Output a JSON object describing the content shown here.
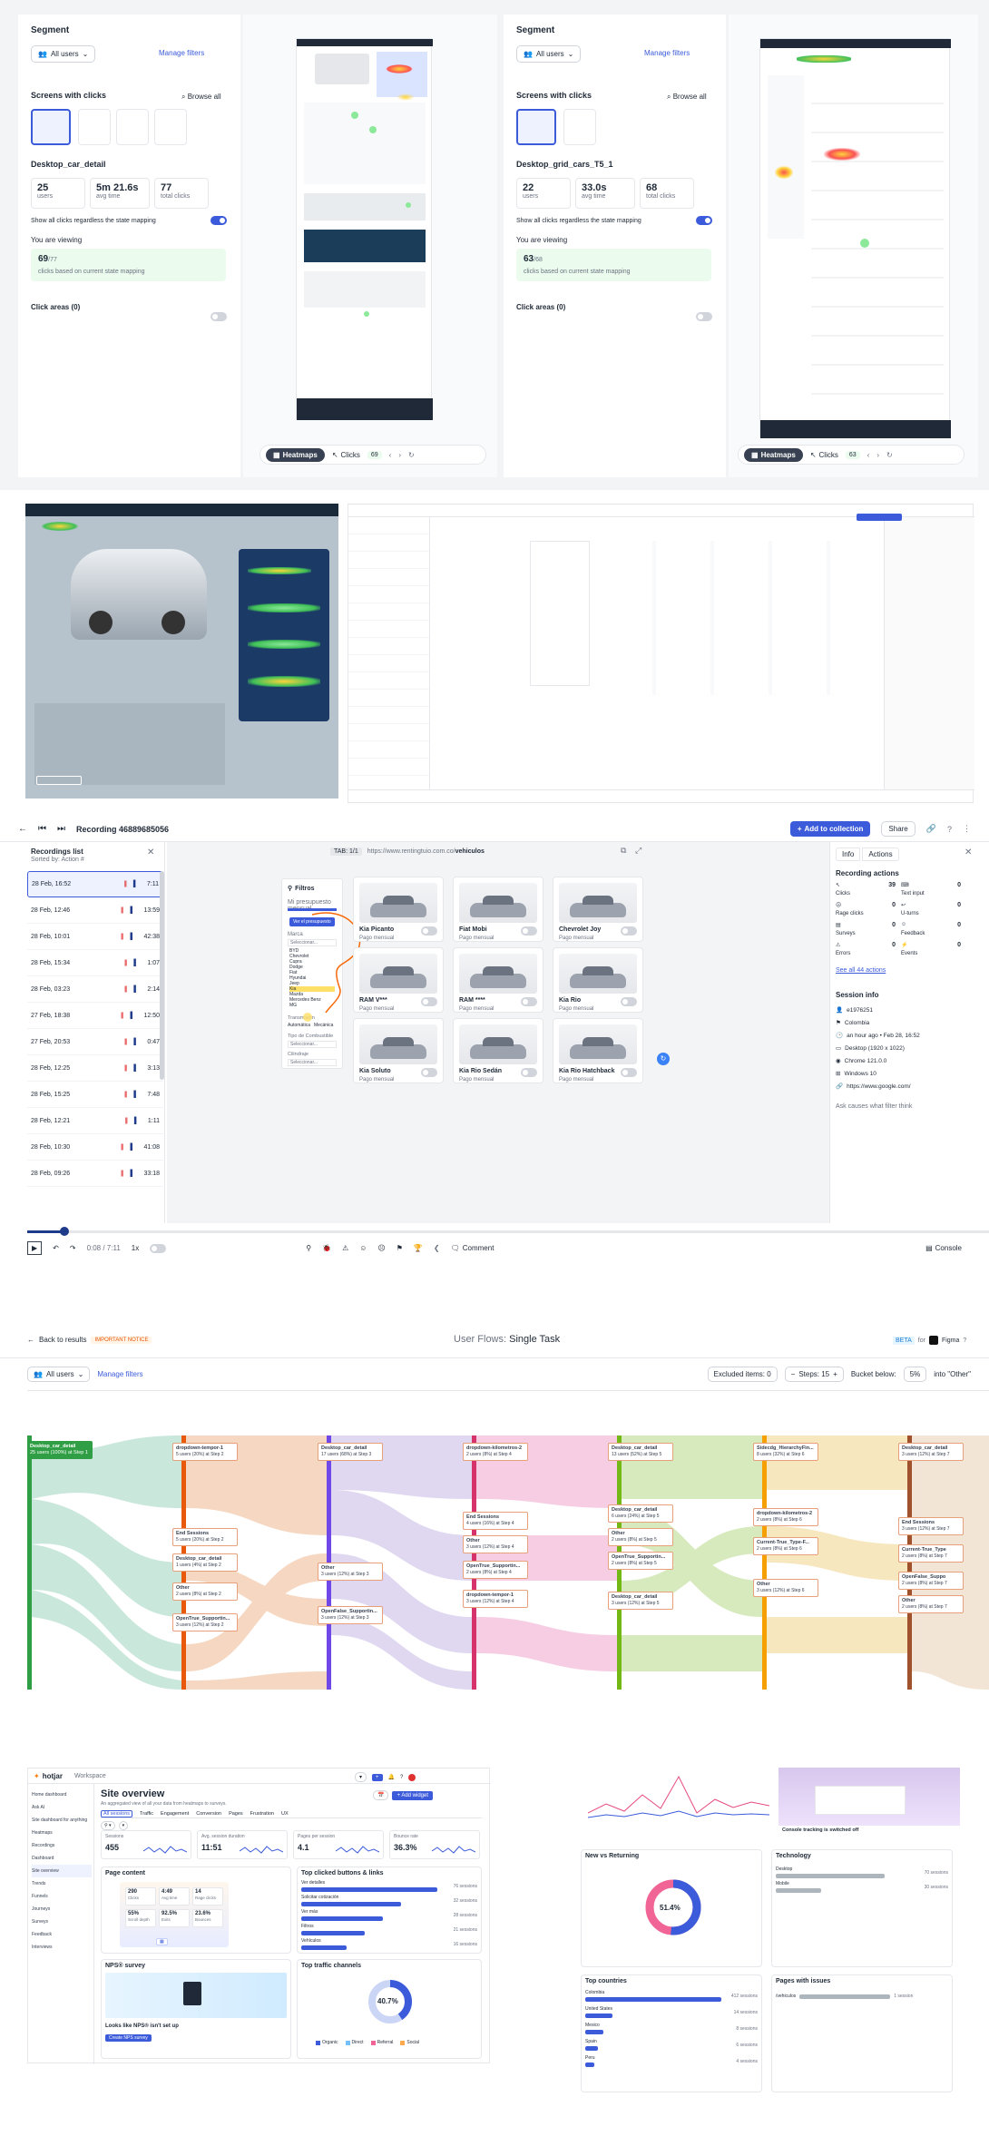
{
  "panel1": {
    "segment_label": "Segment",
    "segment_value": "All users",
    "manage_filters": "Manage filters",
    "screens_label": "Screens with clicks",
    "browse_all": "Browse all",
    "screen_name": "Desktop_car_detail",
    "stats": [
      {
        "value": "25",
        "label": "users"
      },
      {
        "value": "5m 21.6s",
        "label": "avg time"
      },
      {
        "value": "77",
        "label": "total clicks"
      }
    ],
    "show_all_clicks": "Show all clicks regardless the state mapping",
    "viewing_label": "You are viewing",
    "viewing_count": "69",
    "viewing_total": "/77",
    "viewing_sub": "clicks based on current state mapping",
    "click_areas": "Click areas (0)",
    "tab_heatmaps": "Heatmaps",
    "tab_clicks": "Clicks",
    "clicks_badge": "69"
  },
  "panel2": {
    "segment_label": "Segment",
    "segment_value": "All users",
    "manage_filters": "Manage filters",
    "screens_label": "Screens with clicks",
    "browse_all": "Browse all",
    "screen_name": "Desktop_grid_cars_T5_1",
    "stats": [
      {
        "value": "22",
        "label": "users"
      },
      {
        "value": "33.0s",
        "label": "avg time"
      },
      {
        "value": "68",
        "label": "total clicks"
      }
    ],
    "show_all_clicks": "Show all clicks regardless the state mapping",
    "viewing_label": "You are viewing",
    "viewing_count": "63",
    "viewing_total": "/68",
    "viewing_sub": "clicks based on current state mapping",
    "click_areas": "Click areas (0)",
    "tab_heatmaps": "Heatmaps",
    "tab_clicks": "Clicks",
    "clicks_badge": "63"
  },
  "recording": {
    "title": "Recording 46889685056",
    "add_collection": "Add to collection",
    "share": "Share",
    "list_title": "Recordings list",
    "list_sub": "Sorted by: Action #",
    "tab": "TAB: 1/1",
    "url_base": "https://www.rentingtuio.com.co/",
    "url_path": "vehiculos",
    "recordings": [
      {
        "date": "28 Feb, 16:52",
        "dur": "7:11"
      },
      {
        "date": "28 Feb, 12:46",
        "dur": "13:59"
      },
      {
        "date": "28 Feb, 10:01",
        "dur": "42:38"
      },
      {
        "date": "28 Feb, 15:34",
        "dur": "1:07"
      },
      {
        "date": "28 Feb, 03:23",
        "dur": "2:14"
      },
      {
        "date": "27 Feb, 18:38",
        "dur": "12:50"
      },
      {
        "date": "27 Feb, 20:53",
        "dur": "0:47"
      },
      {
        "date": "28 Feb, 12:25",
        "dur": "3:13"
      },
      {
        "date": "28 Feb, 15:25",
        "dur": "7:48"
      },
      {
        "date": "28 Feb, 12:21",
        "dur": "1:11"
      },
      {
        "date": "28 Feb, 10:30",
        "dur": "41:08"
      },
      {
        "date": "28 Feb, 09:26",
        "dur": "33:18"
      }
    ],
    "filters_title": "Filtros",
    "filter_budget": "Mi presupuesto mensual",
    "filter_button": "Ver el presupuesto",
    "filter_brand": "Marca",
    "filter_select": "Seleccionar...",
    "brands": [
      "BYD",
      "Chevrolet",
      "Cupra",
      "Dodge",
      "Fiat",
      "Hyundai",
      "Jeep",
      "Kia",
      "Mazda",
      "Mercedes Benz",
      "MG"
    ],
    "filter_trans": "Transmisión",
    "trans_opts": [
      "Automática",
      "Mecánica"
    ],
    "filter_fuel": "Tipo de Combustible",
    "filter_body": "Cilindraje",
    "cars": [
      {
        "name": "Kia Picanto",
        "price": "Pago mensual"
      },
      {
        "name": "Fiat Mobi",
        "price": "Pago mensual"
      },
      {
        "name": "Chevrolet Joy",
        "price": "Pago mensual"
      },
      {
        "name": "RAM V***",
        "price": "Pago mensual"
      },
      {
        "name": "RAM ****",
        "price": "Pago mensual"
      },
      {
        "name": "Kia Rio",
        "price": "Pago mensual"
      },
      {
        "name": "Kia Soluto",
        "price": "Pago mensual"
      },
      {
        "name": "Kia Rio Sedán",
        "price": "Pago mensual"
      },
      {
        "name": "Kia Rio Hatchback",
        "price": "Pago mensual"
      }
    ],
    "tab_info": "Info",
    "tab_actions": "Actions",
    "rec_actions_title": "Recording actions",
    "actions": [
      {
        "label": "Clicks",
        "value": "39"
      },
      {
        "label": "Text input",
        "value": "0"
      },
      {
        "label": "Rage clicks",
        "value": "0"
      },
      {
        "label": "U-turns",
        "value": "0"
      },
      {
        "label": "Surveys",
        "value": "0"
      },
      {
        "label": "Feedback",
        "value": "0"
      },
      {
        "label": "Errors",
        "value": "0"
      },
      {
        "label": "Events",
        "value": "0"
      }
    ],
    "see_all": "See all 44 actions",
    "session_title": "Session info",
    "session": [
      "e1976251",
      "Colombia",
      "an hour ago • Feb 28, 16:52",
      "Desktop (1920 x 1022)",
      "Chrome 121.0.0",
      "Windows 10",
      "https://www.google.com/"
    ],
    "ask": "Ask causes what filter think",
    "time": "0:08 / 7:11",
    "speed": "1x",
    "comment": "Comment",
    "console": "Console"
  },
  "flows": {
    "back": "Back to results",
    "notice": "IMPORTANT NOTICE",
    "title_prefix": "User Flows: ",
    "title": "Single Task",
    "beta": "BETA",
    "for": "for",
    "figma": "Figma",
    "segment": "All users",
    "manage": "Manage filters",
    "excluded": "Excluded items: 0",
    "steps": "Steps: 15",
    "bucket": "Bucket below:",
    "bucket_val": "5%",
    "into_other": "into \"Other\"",
    "start_node": {
      "title": "Desktop_car_detail",
      "sub": "25 users (100%) at Step 1"
    },
    "nodes": [
      {
        "title": "dropdown-tempor-1",
        "sub": "5 users (20%) at Step 2"
      },
      {
        "title": "End Sessions",
        "sub": "5 users (20%) at Step 2"
      },
      {
        "title": "Desktop_car_detail",
        "sub": "1 users (4%) at Step 2"
      },
      {
        "title": "Other",
        "sub": "2 users (8%) at Step 2"
      },
      {
        "title": "OpenTrue_Supportin...",
        "sub": "3 users (12%) at Step 2"
      },
      {
        "title": "Desktop_car_detail",
        "sub": "17 users (68%) at Step 3"
      },
      {
        "title": "Other",
        "sub": "3 users (12%) at Step 3"
      },
      {
        "title": "OpenFalse_Supportin...",
        "sub": "3 users (12%) at Step 3"
      },
      {
        "title": "dropdown-kilometros-2",
        "sub": "2 users (8%) at Step 4"
      },
      {
        "title": "End Sessions",
        "sub": "4 users (16%) at Step 4"
      },
      {
        "title": "Other",
        "sub": "3 users (12%) at Step 4"
      },
      {
        "title": "OpenTrue_Supportin...",
        "sub": "2 users (8%) at Step 4"
      },
      {
        "title": "dropdown-tempor-1",
        "sub": "3 users (12%) at Step 4"
      },
      {
        "title": "Desktop_car_detail",
        "sub": "13 users (52%) at Step 5"
      },
      {
        "title": "Desktop_car_detail",
        "sub": "6 users (24%) at Step 5"
      },
      {
        "title": "Other",
        "sub": "2 users (8%) at Step 5"
      },
      {
        "title": "OpenTrue_Supportin...",
        "sub": "2 users (8%) at Step 5"
      },
      {
        "title": "Desktop_car_detail",
        "sub": "3 users (12%) at Step 5"
      },
      {
        "title": "Sidecdg_HierarchyFin...",
        "sub": "8 users (32%) at Step 6"
      },
      {
        "title": "dropdown-kilometros-2",
        "sub": "2 users (8%) at Step 6"
      },
      {
        "title": "Current-True_Type-F...",
        "sub": "2 users (8%) at Step 6"
      },
      {
        "title": "Other",
        "sub": "3 users (12%) at Step 6"
      },
      {
        "title": "Desktop_car_detail",
        "sub": "3 users (12%) at Step 7"
      },
      {
        "title": "End Sessions",
        "sub": "3 users (12%) at Step 7"
      },
      {
        "title": "Current-True_Type",
        "sub": "2 users (8%) at Step 7"
      },
      {
        "title": "OpenFalse_Suppo",
        "sub": "2 users (8%) at Step 7"
      },
      {
        "title": "Other",
        "sub": "2 users (8%) at Step 7"
      }
    ]
  },
  "dashboard": {
    "logo": "hotjar",
    "workspace": "Workspace",
    "nav": [
      "Home dashboard",
      "Ask AI",
      "Site dashboard for anything",
      "Heatmaps",
      "Recordings",
      "Dashboard",
      "Site overview",
      "Trends",
      "Funnels",
      "Journeys",
      "Surveys",
      "Feedback",
      "Interviews"
    ],
    "title": "Site overview",
    "subtitle": "An aggregated view of all your data from heatmaps to surveys.",
    "tabs": [
      "All sessions",
      "Traffic",
      "Engagement",
      "Conversion",
      "Pages",
      "Frustration",
      "UX"
    ],
    "kpis": [
      {
        "label": "Sessions",
        "value": "455"
      },
      {
        "label": "Avg. session duration",
        "value": "11:51"
      },
      {
        "label": "Pages per session",
        "value": "4.1"
      },
      {
        "label": "Bounce rate",
        "value": "36.3%"
      }
    ],
    "page_content_title": "Page content",
    "mini_stats": [
      {
        "value": "290",
        "label": "Clicks"
      },
      {
        "value": "4:49",
        "label": "Avg time"
      },
      {
        "value": "14",
        "label": "Rage clicks"
      },
      {
        "value": "55%",
        "label": "Scroll depth"
      },
      {
        "value": "92.5%",
        "label": "Exits"
      },
      {
        "value": "23.6%",
        "label": "Bounces"
      }
    ],
    "top_clicked_title": "Top clicked buttons & links",
    "top_clicked": [
      {
        "label": "Ver detalles",
        "count": "76 sessions"
      },
      {
        "label": "Solicitar cotización",
        "count": "32 sessions"
      },
      {
        "label": "Ver más",
        "count": "28 sessions"
      },
      {
        "label": "Filtros",
        "count": "21 sessions"
      },
      {
        "label": "Vehículos",
        "count": "16 sessions"
      }
    ],
    "nps_title": "NPS® survey",
    "nps_text": "Looks like NPS® isn't set up",
    "nps_button": "Create NPS survey",
    "traffic_title": "Top traffic channels",
    "donut_value": "40.7%",
    "donut2_value": "51.4%",
    "legend": [
      "Organic",
      "Direct",
      "Referral",
      "Social"
    ],
    "new_vs_returning": "New vs Returning",
    "technology": "Technology",
    "tech_items": [
      {
        "label": "Desktop",
        "count": "70 sessions"
      },
      {
        "label": "Mobile",
        "count": "30 sessions"
      }
    ],
    "console_title": "Console tracking is switched off",
    "console_btn": "Switch on console tracking",
    "top_countries": "Top countries",
    "countries": [
      {
        "label": "Colombia",
        "count": "412 sessions"
      },
      {
        "label": "United States",
        "count": "14 sessions"
      },
      {
        "label": "Mexico",
        "count": "8 sessions"
      },
      {
        "label": "Spain",
        "count": "6 sessions"
      },
      {
        "label": "Peru",
        "count": "4 sessions"
      }
    ],
    "pages_issues": "Pages with issues",
    "issue_row": "/vehiculos",
    "issue_count": "1 session"
  },
  "colors": {
    "accent": "#3b5bdb",
    "green": "#2f9e44",
    "sankey_orange": "#f0b88f",
    "sankey_purple": "#c7b7e6",
    "sankey_pink": "#f2a6cf",
    "sankey_green": "#b7d98a",
    "sankey_yellow": "#f2d48a",
    "sankey_teal": "#8fd0b8"
  }
}
